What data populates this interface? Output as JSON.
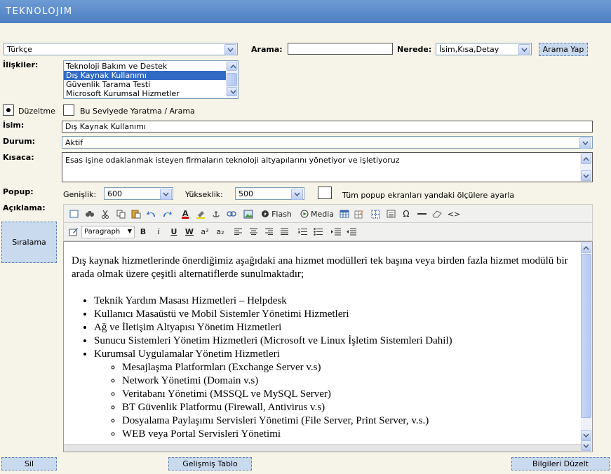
{
  "app": {
    "title": "TEKNOLOJIM"
  },
  "language_select": {
    "value": "Türkçe"
  },
  "search": {
    "label": "Arama:",
    "value": "",
    "where_label": "Nerede:",
    "where_value": "İsim,Kısa,Detay",
    "button": "Arama Yap"
  },
  "relations": {
    "label": "İlişkiler:",
    "items": [
      "Teknoloji Bakım ve Destek",
      "Dış Kaynak Kullanımı",
      "Güvenlik Tarama Testi",
      "Microsoft Kurumsal Hizmetler"
    ]
  },
  "mode": {
    "edit_label": "Düzeltme",
    "create_label": "Bu Seviyede Yaratma / Arama"
  },
  "name": {
    "label": "İsim:",
    "value": "Dış Kaynak Kullanımı"
  },
  "status": {
    "label": "Durum:",
    "value": "Aktif"
  },
  "summary": {
    "label": "Kısaca:",
    "value": "Esas işine odaklanmak isteyen firmaların teknoloji altyapılarını yönetiyor ve işletiyoruz"
  },
  "popup": {
    "label": "Popup:",
    "width_label": "Genişlik:",
    "width_value": "600",
    "height_label": "Yükseklik:",
    "height_value": "500",
    "apply_all_label": "Tüm popup ekranları yandaki ölçülere ayarla"
  },
  "description": {
    "label": "Açıklama:"
  },
  "sort_button": "Sıralama",
  "toolbar": {
    "flash": "Flash",
    "media": "Media",
    "format_value": "Paragraph",
    "italic": "i",
    "bold": "B",
    "underline": "U",
    "strike": "W",
    "superscript": "a²",
    "subscript": "a₂"
  },
  "editor": {
    "intro": "Dış kaynak hizmetlerinde önerdiğimiz aşağıdaki ana hizmet modülleri tek başına veya birden fazla hizmet modülü bir arada olmak üzere çeşitli alternatiflerde sunulmaktadır;",
    "items": [
      "Teknik Yardım Masası Hizmetleri – Helpdesk",
      "Kullanıcı Masaüstü ve Mobil Sistemler Yönetimi Hizmetleri",
      "Ağ ve İletişim Altyapısı Yönetim Hizmetleri",
      "Sunucu Sistemleri Yönetim Hizmetleri (Microsoft ve Linux İşletim Sistemleri Dahil)",
      "Kurumsal Uygulamalar Yönetim Hizmetleri"
    ],
    "subitems": [
      "Mesajlaşma Platformları (Exchange Server v.s)",
      "Network Yönetimi (Domain v.s)",
      "Veritabanı Yönetimi (MSSQL ve MySQL Server)",
      "BT Güvenlik Platformu (Firewall, Antivirus v.s)",
      "Dosyalama Paylaşımı Servisleri Yönetimi (File Server, Print Server, v.s.)",
      "WEB veya Portal Servisleri Yönetimi"
    ]
  },
  "bottom": {
    "delete": "Sil",
    "advanced_table": "Gelişmiş Tablo",
    "save": "Bilgileri Düzelt"
  }
}
